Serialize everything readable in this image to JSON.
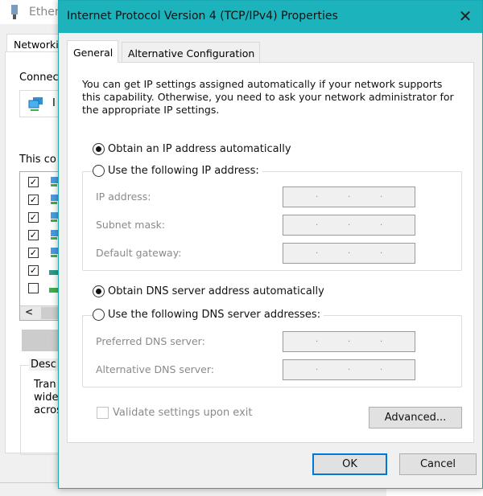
{
  "background_window": {
    "title": "Ether",
    "tab": "Networki",
    "connect_label": "Connec",
    "adapter_label": "I",
    "components_label": "This co",
    "components": [
      {
        "checked": true
      },
      {
        "checked": true
      },
      {
        "checked": true
      },
      {
        "checked": true
      },
      {
        "checked": true
      },
      {
        "checked": true
      },
      {
        "checked": false
      }
    ],
    "scroll_left": "<",
    "description_label": "Desc",
    "description_lines": [
      "Tran",
      "wide",
      "acros"
    ]
  },
  "dialog": {
    "title": "Internet Protocol Version 4 (TCP/IPv4) Properties",
    "close_icon": "✕",
    "tabs": [
      {
        "label": "General",
        "active": true
      },
      {
        "label": "Alternative Configuration",
        "active": false
      }
    ],
    "intro": "You can get IP settings assigned automatically if your network supports this capability. Otherwise, you need to ask your network administrator for the appropriate IP settings.",
    "ip": {
      "auto_label": "Obtain an IP address automatically",
      "manual_label": "Use the following IP address:",
      "selected": "auto",
      "fields": [
        {
          "label": "IP address:",
          "value": ""
        },
        {
          "label": "Subnet mask:",
          "value": ""
        },
        {
          "label": "Default gateway:",
          "value": ""
        }
      ]
    },
    "dns": {
      "auto_label": "Obtain DNS server address automatically",
      "manual_label": "Use the following DNS server addresses:",
      "selected": "auto",
      "fields": [
        {
          "label": "Preferred DNS server:",
          "value": ""
        },
        {
          "label": "Alternative DNS server:",
          "value": ""
        }
      ]
    },
    "validate_label": "Validate settings upon exit",
    "validate_checked": false,
    "advanced_label": "Advanced...",
    "ok_label": "OK",
    "cancel_label": "Cancel",
    "accent_color": "#1cb3bd",
    "focus_color": "#0078d7"
  }
}
